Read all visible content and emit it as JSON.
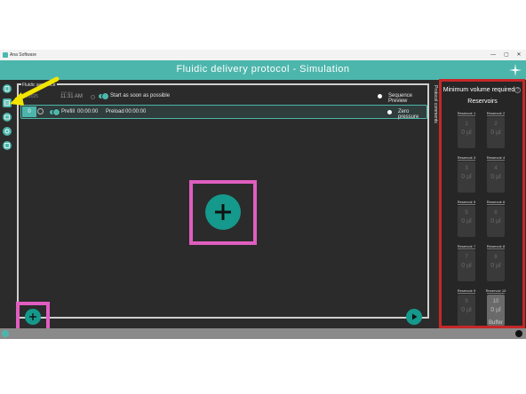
{
  "window": {
    "app_title": "Ana Software",
    "controls": [
      "—",
      "▢",
      "✕"
    ]
  },
  "header": {
    "title": "Fluidic delivery protocol - Simulation"
  },
  "nav": {
    "items": [
      "protocol-icon",
      "sequence-icon",
      "video-icon",
      "settings-icon",
      "calibration-icon"
    ]
  },
  "sequence": {
    "label": "Fluidic sequence",
    "date": "06.2025",
    "start_time_label": "Start time",
    "start_time": "11:31 AM",
    "start_option": "Start as soon as possible",
    "sequence_preview": "Sequence Preview"
  },
  "step": {
    "number": "0",
    "prefill_label": "Prefill",
    "prefill_time": "00:00:00",
    "preload_label": "Preload",
    "preload_time": "00:00:00",
    "zero_pressure": "Zero pressure"
  },
  "protocol_comments": "Protocol comments",
  "right_panel": {
    "min_volume": "Minimum volume required",
    "help": "?",
    "reservoirs_title": "Reservoirs",
    "reservoirs": [
      {
        "name": "Reservoir 1",
        "index": "1",
        "volume": "0 µl"
      },
      {
        "name": "Reservoir 2",
        "index": "2",
        "volume": "0 µl"
      },
      {
        "name": "Reservoir 3",
        "index": "3",
        "volume": "0 µl"
      },
      {
        "name": "Reservoir 4",
        "index": "4",
        "volume": "0 µl"
      },
      {
        "name": "Reservoir 5",
        "index": "5",
        "volume": "0 µl"
      },
      {
        "name": "Reservoir 6",
        "index": "6",
        "volume": "0 µl"
      },
      {
        "name": "Reservoir 7",
        "index": "7",
        "volume": "0 µl"
      },
      {
        "name": "Reservoir 8",
        "index": "8",
        "volume": "0 µl"
      },
      {
        "name": "Reservoir 9",
        "index": "9",
        "volume": "0 µl"
      },
      {
        "name": "Reservoir 10",
        "index": "10",
        "volume": "0 µl",
        "label": "Buffer"
      }
    ]
  },
  "colors": {
    "accent": "#4db6ac",
    "button": "#15998c",
    "highlight_pink": "#e05ec0",
    "highlight_red": "#c62828",
    "arrow_yellow": "#f2e600"
  }
}
